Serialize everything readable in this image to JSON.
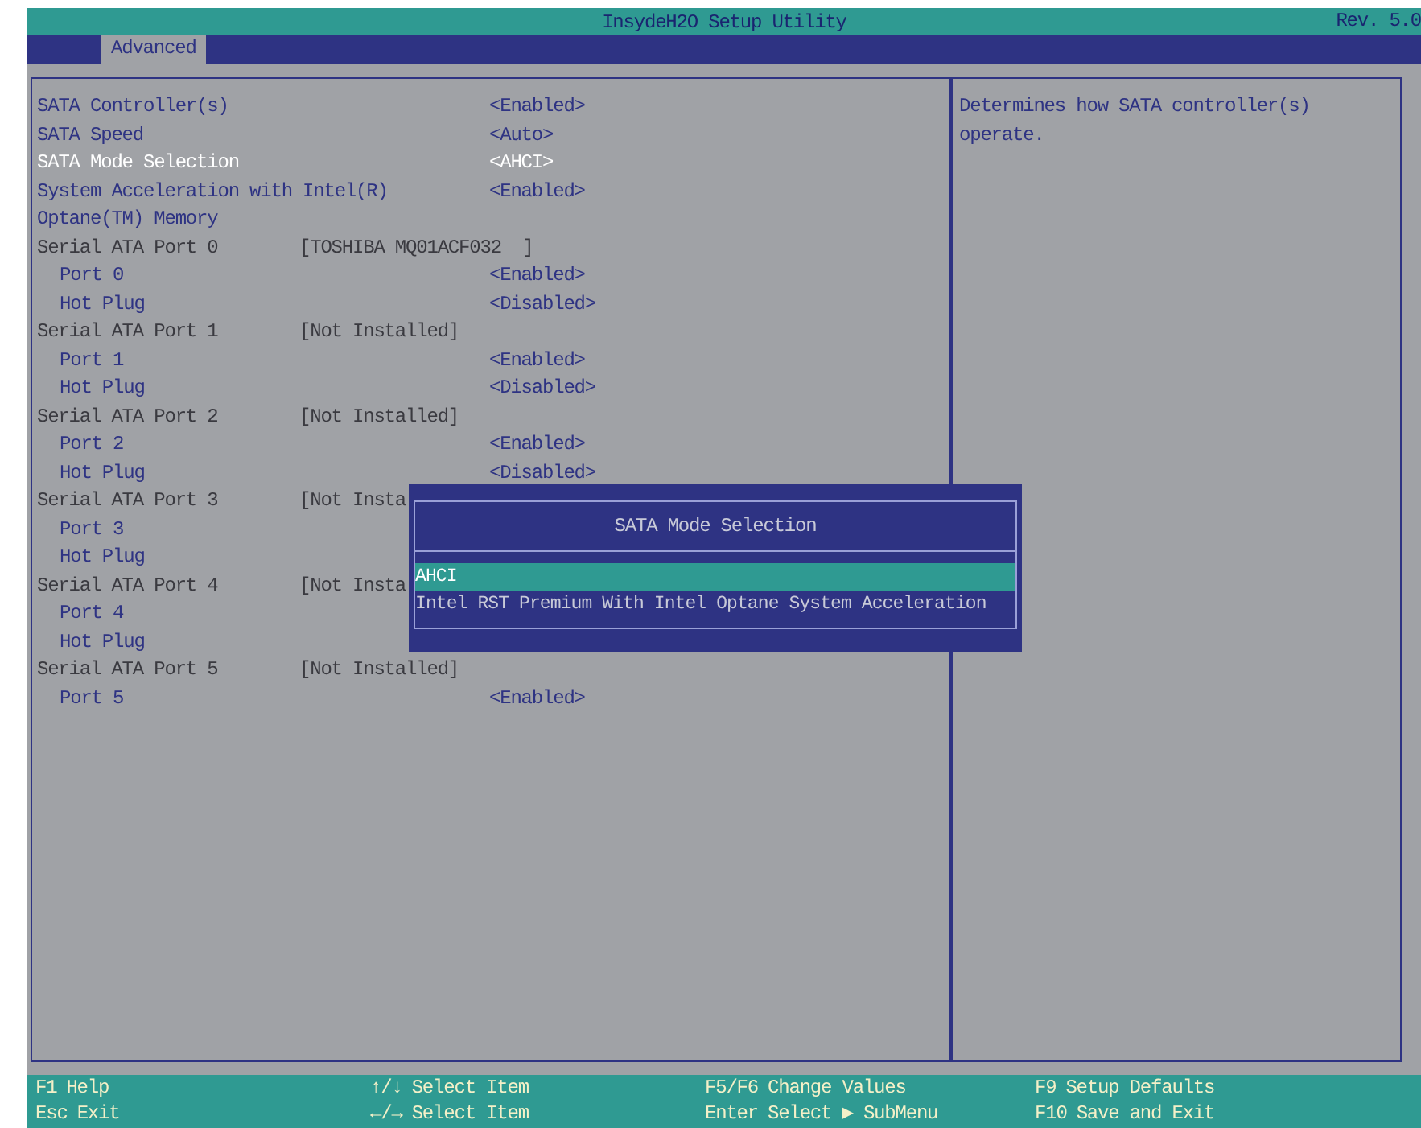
{
  "window": {
    "title": "InsydeH2O Setup Utility",
    "revision": "Rev. 5.0"
  },
  "tabs": [
    {
      "label": "Advanced",
      "selected": true
    }
  ],
  "items": [
    {
      "kind": "option",
      "label": "SATA Controller(s)",
      "value": "<Enabled>",
      "selected": false
    },
    {
      "kind": "option",
      "label": "SATA Speed",
      "value": "<Auto>",
      "selected": false
    },
    {
      "kind": "option",
      "label": "SATA Mode Selection",
      "value": "<AHCI>",
      "selected": true
    },
    {
      "kind": "option",
      "label": "System Acceleration with Intel(R) Optane(TM) Memory",
      "value": "<Enabled>",
      "selected": false
    },
    {
      "kind": "info",
      "label": "Serial ATA Port 0",
      "info": "[TOSHIBA MQ01ACF032  ]",
      "children": [
        {
          "kind": "option",
          "label": "Port 0",
          "value": "<Enabled>",
          "selected": false
        },
        {
          "kind": "option",
          "label": "Hot Plug",
          "value": "<Disabled>",
          "selected": false
        }
      ]
    },
    {
      "kind": "info",
      "label": "Serial ATA Port 1",
      "info": "[Not Installed]",
      "children": [
        {
          "kind": "option",
          "label": "Port 1",
          "value": "<Enabled>",
          "selected": false
        },
        {
          "kind": "option",
          "label": "Hot Plug",
          "value": "<Disabled>",
          "selected": false
        }
      ]
    },
    {
      "kind": "info",
      "label": "Serial ATA Port 2",
      "info": "[Not Installed]",
      "children": [
        {
          "kind": "option",
          "label": "Port 2",
          "value": "<Enabled>",
          "selected": false
        },
        {
          "kind": "option",
          "label": "Hot Plug",
          "value": "<Disabled>",
          "selected": false
        }
      ]
    },
    {
      "kind": "info",
      "label": "Serial ATA Port 3",
      "info": "[Not Insta",
      "children": [
        {
          "kind": "option",
          "label": "Port 3",
          "selected": false
        },
        {
          "kind": "option",
          "label": "Hot Plug",
          "selected": false
        }
      ]
    },
    {
      "kind": "info",
      "label": "Serial ATA Port 4",
      "info": "[Not Insta",
      "children": [
        {
          "kind": "option",
          "label": "Port 4",
          "selected": false
        },
        {
          "kind": "option",
          "label": "Hot Plug",
          "selected": false
        }
      ]
    },
    {
      "kind": "info",
      "label": "Serial ATA Port 5",
      "info": "[Not Installed]",
      "children": [
        {
          "kind": "option",
          "label": "Port 5",
          "value": "<Enabled>",
          "selected": false
        }
      ]
    }
  ],
  "help": "Determines how SATA controller(s) operate.",
  "popup": {
    "title": "SATA Mode Selection",
    "options": [
      {
        "label": "AHCI",
        "selected": true
      },
      {
        "label": "Intel RST Premium With Intel Optane System Acceleration",
        "selected": false
      }
    ]
  },
  "footer": [
    [
      {
        "key": "F1",
        "text": "Help"
      },
      {
        "key": "Esc",
        "text": "Exit"
      }
    ],
    [
      {
        "key": "↑/↓",
        "text": "Select Item"
      },
      {
        "key": "←/→",
        "text": "Select Item"
      }
    ],
    [
      {
        "key": "F5/F6",
        "text": "Change Values"
      },
      {
        "key": "Enter",
        "text": "Select ▶ SubMenu"
      }
    ],
    [
      {
        "key": "F9",
        "text": "Setup Defaults"
      },
      {
        "key": "F10",
        "text": "Save and Exit"
      }
    ]
  ]
}
